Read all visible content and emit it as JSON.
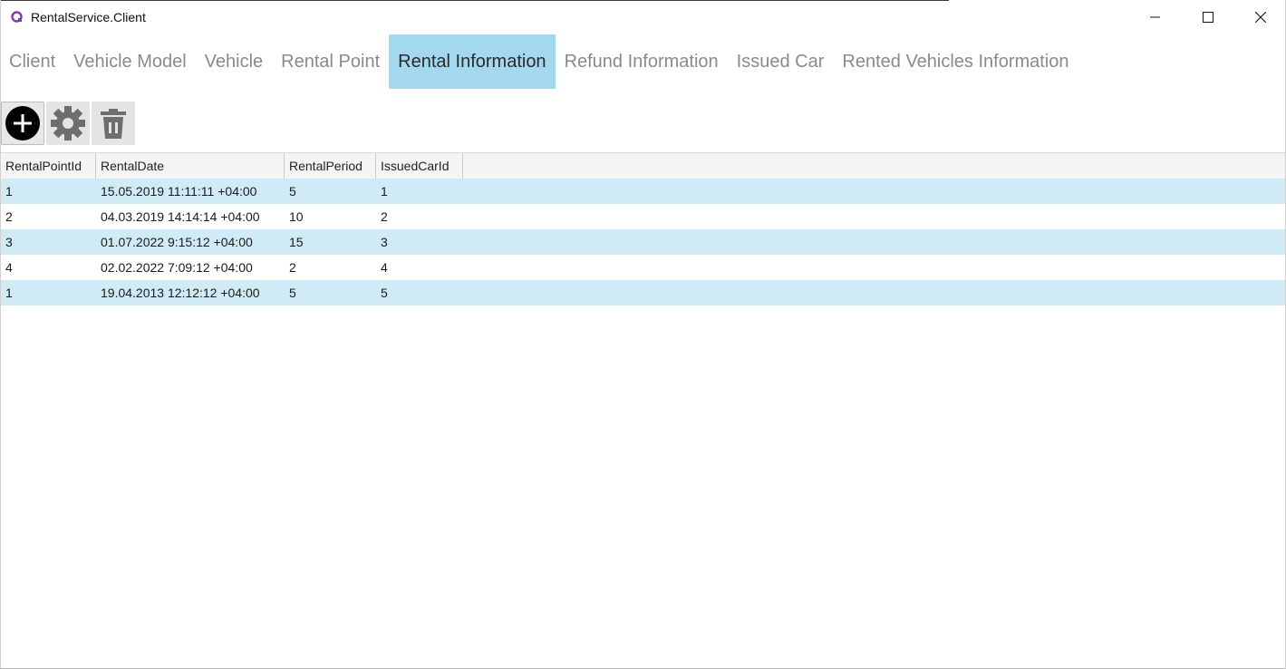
{
  "window": {
    "title": "RentalService.Client"
  },
  "tabs": [
    {
      "label": "Client",
      "active": false
    },
    {
      "label": "Vehicle Model",
      "active": false
    },
    {
      "label": "Vehicle",
      "active": false
    },
    {
      "label": "Rental Point",
      "active": false
    },
    {
      "label": "Rental Information",
      "active": true
    },
    {
      "label": "Refund Information",
      "active": false
    },
    {
      "label": "Issued Car",
      "active": false
    },
    {
      "label": "Rented Vehicles Information",
      "active": false
    }
  ],
  "toolbar": {
    "buttons": [
      {
        "icon": "plus-circle-icon"
      },
      {
        "icon": "gear-icon"
      },
      {
        "icon": "trash-icon"
      }
    ]
  },
  "grid": {
    "columns": [
      "RentalPointId",
      "RentalDate",
      "RentalPeriod",
      "IssuedCarId"
    ],
    "rows": [
      [
        "1",
        "15.05.2019 11:11:11 +04:00",
        "5",
        "1"
      ],
      [
        "2",
        "04.03.2019 14:14:14 +04:00",
        "10",
        "2"
      ],
      [
        "3",
        "01.07.2022 9:15:12 +04:00",
        "15",
        "3"
      ],
      [
        "4",
        "02.02.2022 7:09:12 +04:00",
        "2",
        "4"
      ],
      [
        "1",
        "19.04.2013 12:12:12 +04:00",
        "5",
        "5"
      ]
    ]
  },
  "colors": {
    "active_tab": "#a3d8ee",
    "row_highlight": "#d0ebf6",
    "tab_text": "#8a8a8a"
  }
}
